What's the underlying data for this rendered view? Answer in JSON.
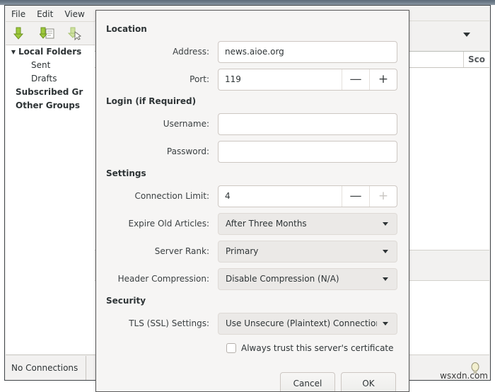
{
  "background_window": {
    "menubar": [
      {
        "label": "File",
        "name": "menu-file"
      },
      {
        "label": "Edit",
        "name": "menu-edit"
      },
      {
        "label": "View",
        "name": "menu-view"
      }
    ],
    "toolbar": [
      {
        "icon": "download-arrow-icon",
        "tooltip": "Get Messages"
      },
      {
        "icon": "download-document-icon",
        "tooltip": "Get Headers"
      },
      {
        "icon": "download-cursor-icon",
        "tooltip": "Get Selected"
      }
    ],
    "tree": [
      {
        "label": "Local Folders",
        "bold": true,
        "expanded": true,
        "level": 0
      },
      {
        "label": "Sent",
        "bold": false,
        "level": 1
      },
      {
        "label": "Drafts",
        "bold": false,
        "level": 1
      },
      {
        "label": "Subscribed Gr",
        "bold": true,
        "level": 0
      },
      {
        "label": "Other Groups",
        "bold": true,
        "level": 0
      }
    ],
    "statusbar": {
      "text": "No Connections"
    },
    "columns": [
      {
        "label": "Sco"
      }
    ],
    "watermark": "wsxdn.com"
  },
  "dialog": {
    "sections": {
      "location": {
        "title": "Location",
        "address": {
          "label": "Address:",
          "value": "news.aioe.org",
          "placeholder": ""
        },
        "port": {
          "label": "Port:",
          "value": "119",
          "minus": "—",
          "plus": "+"
        }
      },
      "login": {
        "title": "Login (if Required)",
        "username": {
          "label": "Username:",
          "value": "",
          "placeholder": ""
        },
        "password": {
          "label": "Password:",
          "value": "",
          "placeholder": ""
        }
      },
      "settings": {
        "title": "Settings",
        "connection_limit": {
          "label": "Connection Limit:",
          "value": "4",
          "minus": "—",
          "plus": "+",
          "plus_disabled": true
        },
        "expire_old_articles": {
          "label": "Expire Old Articles:",
          "value": "After Three Months"
        },
        "server_rank": {
          "label": "Server Rank:",
          "value": "Primary"
        },
        "header_compression": {
          "label": "Header Compression:",
          "value": "Disable Compression (N/A)"
        }
      },
      "security": {
        "title": "Security",
        "tls_settings": {
          "label": "TLS (SSL) Settings:",
          "value": "Use Unsecure (Plaintext) Connections"
        },
        "always_trust": {
          "label": "Always trust this server's certificate",
          "checked": false
        }
      }
    },
    "buttons": {
      "cancel": "Cancel",
      "ok": "OK"
    }
  },
  "colors": {
    "dialog_bg": "#f6f5f4",
    "window_bg": "#f2f1f0",
    "text": "#2e3436",
    "input_border": "#cdc7c2",
    "combo_bg": "#ebe9e7",
    "titlebar": "#6d7b89",
    "toolbar_icon_green": "#8ab82e"
  }
}
